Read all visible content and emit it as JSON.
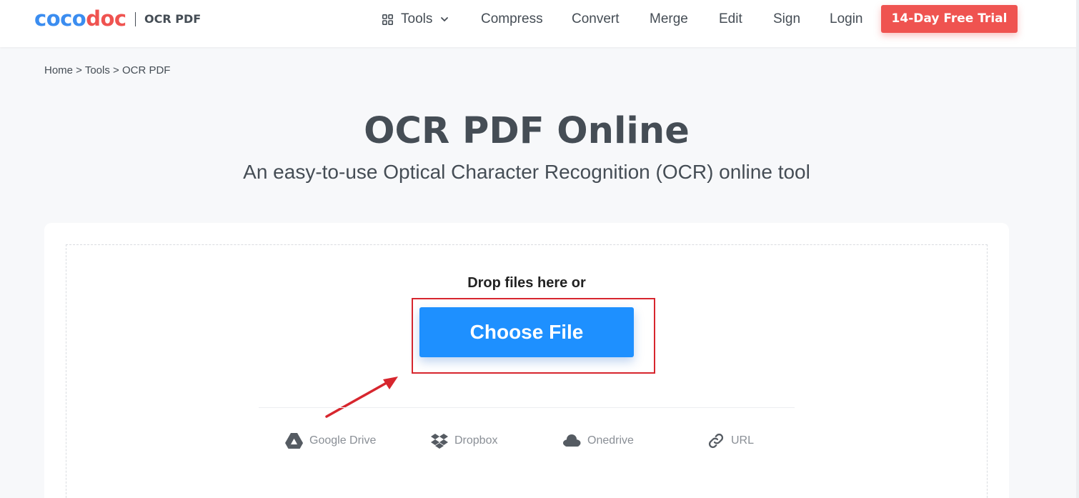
{
  "header": {
    "logo_part1": "coco",
    "logo_part2": "doc",
    "logo_subtitle": "OCR PDF",
    "nav": {
      "tools": "Tools",
      "compress": "Compress",
      "convert": "Convert",
      "merge": "Merge",
      "edit": "Edit",
      "sign": "Sign",
      "login": "Login"
    },
    "trial_button": "14-Day Free Trial"
  },
  "breadcrumb": "Home > Tools > OCR PDF",
  "main": {
    "title": "OCR PDF Online",
    "subtitle": "An easy-to-use Optical Character Recognition (OCR) online tool"
  },
  "upload": {
    "drop_text": "Drop files here or",
    "choose_button": "Choose File",
    "sources": [
      {
        "label": "Google Drive",
        "icon": "google-drive-icon"
      },
      {
        "label": "Dropbox",
        "icon": "dropbox-icon"
      },
      {
        "label": "Onedrive",
        "icon": "onedrive-icon"
      },
      {
        "label": "URL",
        "icon": "link-icon"
      }
    ]
  },
  "colors": {
    "brand_blue": "#3b8df0",
    "brand_red": "#ef5350",
    "button_blue": "#1e90ff",
    "annotation_red": "#d7262e",
    "text": "#454d55"
  }
}
